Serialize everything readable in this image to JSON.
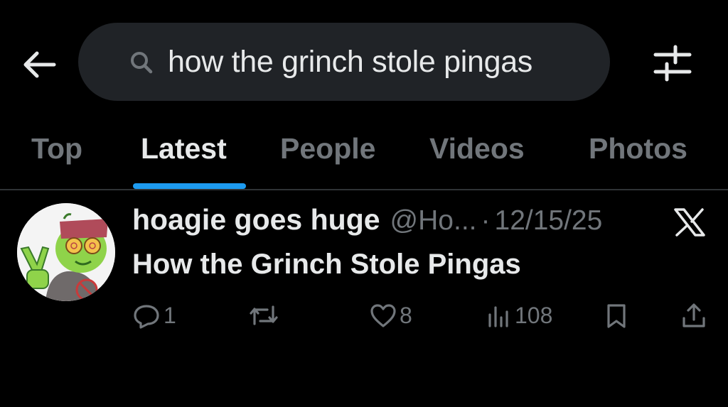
{
  "header": {
    "back_icon": "arrow-left-icon",
    "search": {
      "icon": "search-icon",
      "value": "how the grinch stole pingas"
    },
    "filter_icon": "sliders-icon"
  },
  "tabs": [
    {
      "label": "Top",
      "active": false
    },
    {
      "label": "Latest",
      "active": true
    },
    {
      "label": "People",
      "active": false
    },
    {
      "label": "Videos",
      "active": false
    },
    {
      "label": "Photos",
      "active": false
    }
  ],
  "post": {
    "display_name": "hoagie goes huge",
    "handle": "@Ho...",
    "separator": "·",
    "date": "12/15/25",
    "source_icon": "x-logo-icon",
    "text": "How the Grinch Stole Pingas",
    "actions": {
      "replies": "1",
      "retweets": "",
      "likes": "8",
      "views": "108"
    }
  },
  "colors": {
    "background": "#000000",
    "search_bg": "#202327",
    "accent": "#1d9bf0",
    "text_primary": "#e7e9ea",
    "text_secondary": "#71767b",
    "divider": "#2f3336"
  }
}
